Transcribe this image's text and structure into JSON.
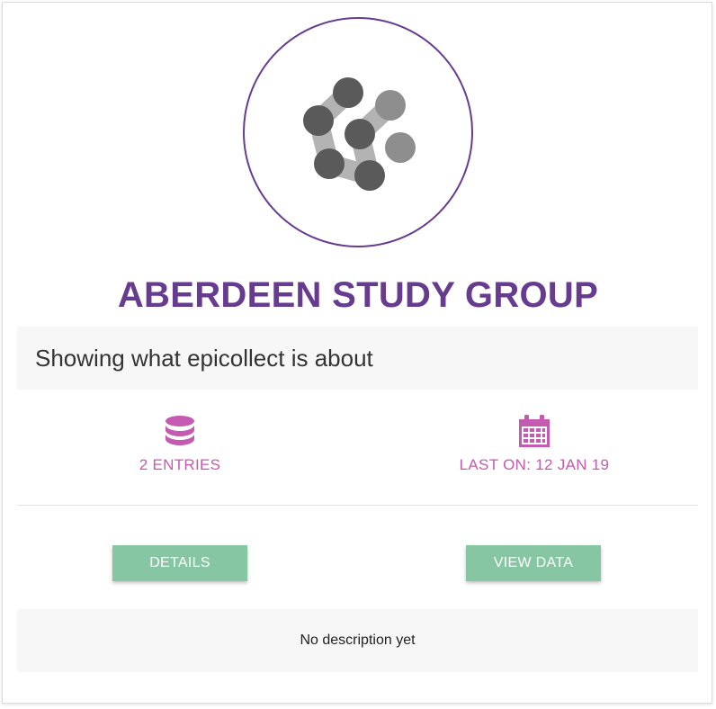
{
  "project": {
    "name": "ABERDEEN STUDY GROUP",
    "small_description": "Showing what epicollect is about",
    "logo_icon": "epicollect-network-logo-icon"
  },
  "stats": {
    "entries_label": "2 ENTRIES",
    "entries_icon": "database-icon",
    "last_on_label": "LAST ON: 12 JAN 19",
    "last_on_icon": "calendar-icon"
  },
  "actions": {
    "details_label": "DETAILS",
    "view_data_label": "VIEW DATA"
  },
  "description": {
    "text": "No description yet"
  },
  "colors": {
    "primary_purple": "#673c90",
    "accent_pink": "#c55bb0",
    "button_green": "#86c6a2",
    "panel_gray": "#f7f7f7"
  }
}
